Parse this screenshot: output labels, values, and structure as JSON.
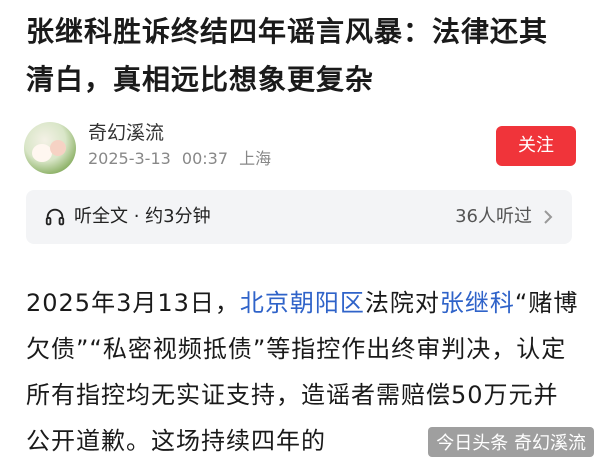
{
  "article": {
    "title_line1": "张继科胜诉终结四年谣言风暴：法律还其",
    "title_line2": "清白，真相远比想象更复杂"
  },
  "author": {
    "name": "奇幻溪流",
    "date": "2025-3-13",
    "time": "00:37",
    "location": "上海",
    "follow_label": "关注"
  },
  "listen": {
    "label": "听全文 · 约3分钟",
    "count": "36人听过"
  },
  "body": {
    "seg1": "2025年3月13日，",
    "link1": "北京朝阳区",
    "seg2": "法院对",
    "link2": "张继科",
    "seg3": "“赌博欠债”“私密视频抵债”等指控作出终审判决，认定所有指控均无实证支持，造谣者需赔偿50万元并公开道歉。这场持续四年的"
  },
  "watermark": "今日头条 奇幻溪流",
  "colors": {
    "follow_button": "#f0343a",
    "link": "#2f63c9",
    "listen_bar_bg": "#f3f4f6"
  },
  "icons": [
    "headphone-icon",
    "chevron-right-icon"
  ]
}
